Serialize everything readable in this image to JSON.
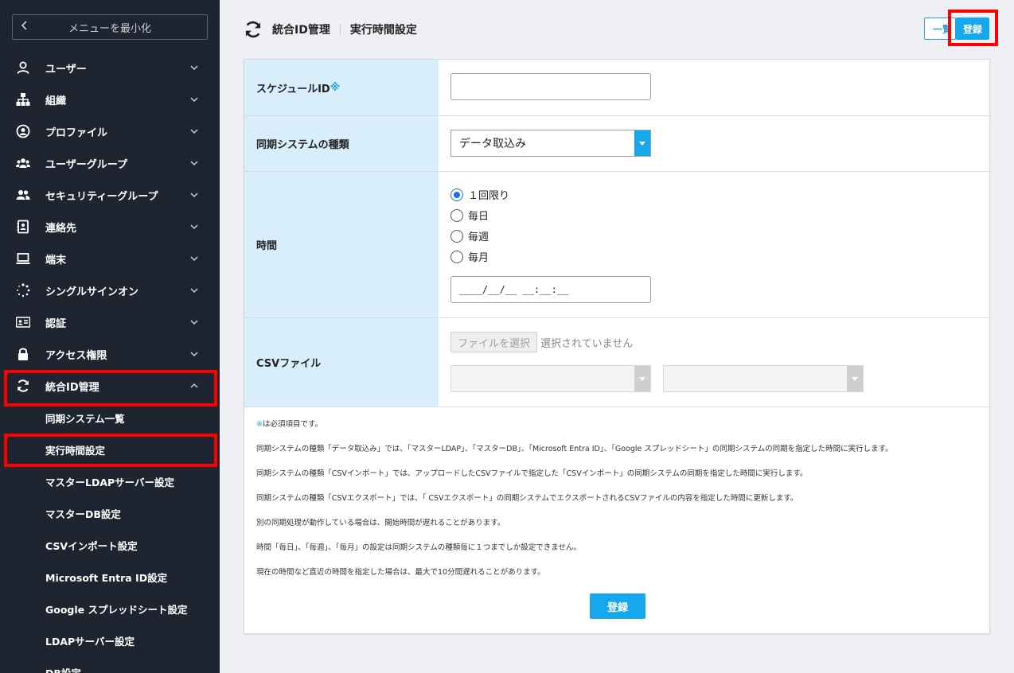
{
  "sidebar": {
    "collapse_label": "メニューを最小化",
    "items": [
      {
        "label": "ユーザー",
        "icon": "user-icon"
      },
      {
        "label": "組織",
        "icon": "org-chart-icon"
      },
      {
        "label": "プロファイル",
        "icon": "profile-icon"
      },
      {
        "label": "ユーザーグループ",
        "icon": "user-group-icon"
      },
      {
        "label": "セキュリティーグループ",
        "icon": "security-group-icon"
      },
      {
        "label": "連絡先",
        "icon": "contacts-icon"
      },
      {
        "label": "端末",
        "icon": "laptop-icon"
      },
      {
        "label": "シングルサインオン",
        "icon": "sso-icon"
      },
      {
        "label": "認証",
        "icon": "id-card-icon"
      },
      {
        "label": "アクセス権限",
        "icon": "lock-icon"
      },
      {
        "label": "統合ID管理",
        "icon": "sync-icon"
      }
    ],
    "sub_items": [
      "同期システム一覧",
      "実行時間設定",
      "マスターLDAPサーバー設定",
      "マスターDB設定",
      "CSVインポート設定",
      "Microsoft Entra ID設定",
      "Google スプレッドシート設定",
      "LDAPサーバー設定",
      "DB設定"
    ]
  },
  "header": {
    "title": "統合ID管理",
    "subtitle": "実行時間設定",
    "list_label": "一覧",
    "save_label": "登録"
  },
  "form": {
    "schedule_id_label": "スケジュールID",
    "required_mark": "※",
    "schedule_id_value": "",
    "sync_type_label": "同期システムの種類",
    "sync_type_value": "データ取込み",
    "time_label": "時間",
    "time_options": [
      "１回限り",
      "毎日",
      "毎週",
      "毎月"
    ],
    "time_selected": "１回限り",
    "datetime_mask": "____/__/__ __:__:__",
    "csv_label": "CSVファイル",
    "file_button": "ファイルを選択",
    "file_status": "選択されていません",
    "save_label": "登録"
  },
  "notes": [
    "は必須項目です。",
    "同期システムの種類「データ取込み」では、「マスターLDAP」、「マスターDB」、「Microsoft Entra ID」、「Google スプレッドシート」の同期システムの同期を指定した時間に実行します。",
    "同期システムの種類「CSVインポート」では、アップロードしたCSVファイルで指定した「CSVインポート」の同期システムの同期を指定した時間に実行します。",
    "同期システムの種類「CSVエクスポート」では、「 CSVエクスポート」の同期システムでエクスポートされるCSVファイルの内容を指定した時間に更新します。",
    "別の同期処理が動作している場合は、開始時間が遅れることがあります。",
    "時間「毎日」、「毎週」、「毎月」の設定は同期システムの種類毎に１つまでしか設定できません。",
    "現在の時間など直近の時間を指定した場合は、最大で10分間遅れることがあります。"
  ],
  "colors": {
    "sidebar_bg": "#1f2530",
    "accent": "#15a8ec",
    "highlight": "#ff0000",
    "label_bg": "#d8eefb"
  }
}
